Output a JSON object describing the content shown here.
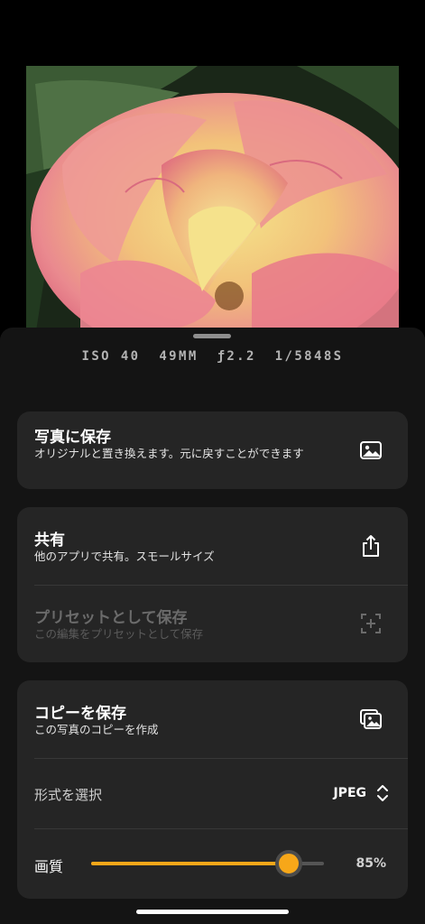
{
  "exif": {
    "iso": "ISO 40",
    "focal": "49MM",
    "aperture": "ƒ2.2",
    "shutter": "1/5848S"
  },
  "save_card": {
    "title": "写真に保存",
    "subtitle": "オリジナルと置き換えます。元に戻すことができます",
    "icon": "photo-icon"
  },
  "share_card": {
    "share": {
      "title": "共有",
      "subtitle": "他のアプリで共有。スモールサイズ",
      "icon": "share-icon"
    },
    "preset": {
      "title": "プリセットとして保存",
      "subtitle": "この編集をプリセットとして保存",
      "icon": "add-preset-icon"
    }
  },
  "copy_card": {
    "copy": {
      "title": "コピーを保存",
      "subtitle": "この写真のコピーを作成",
      "icon": "photo-stack-icon"
    },
    "format": {
      "label": "形式を選択",
      "value": "JPEG"
    },
    "quality": {
      "label": "画質",
      "value_text": "85%",
      "fraction": 0.85
    }
  },
  "colors": {
    "accent": "#f7a719",
    "card": "#252525",
    "sheet": "#141414"
  }
}
